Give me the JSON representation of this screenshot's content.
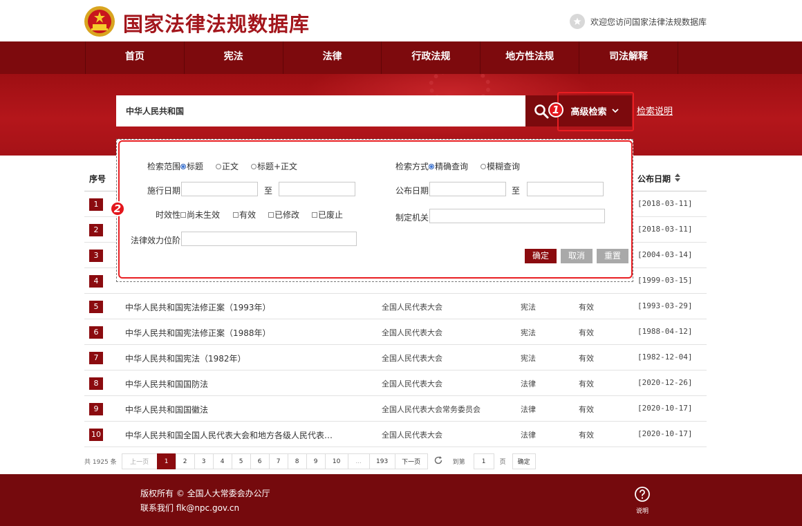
{
  "header": {
    "site_title": "国家法律法规数据库",
    "welcome": "欢迎您访问国家法律法规数据库"
  },
  "nav": [
    "首页",
    "宪法",
    "法律",
    "行政法规",
    "地方性法规",
    "司法解释"
  ],
  "search": {
    "value": "中华人民共和国",
    "advanced_label": "高级检索",
    "help_label": "检索说明"
  },
  "badges": [
    "1",
    "2"
  ],
  "advanced": {
    "scope_label": "检索范围",
    "scope_options": [
      "标题",
      "正文",
      "标题+正文"
    ],
    "method_label": "检索方式",
    "method_options": [
      "精确查询",
      "模糊查询"
    ],
    "exec_date_label": "施行日期",
    "pub_date_label": "公布日期",
    "to_label": "至",
    "validity_label": "时效性",
    "validity_options": [
      "尚未生效",
      "有效",
      "已修改",
      "已废止"
    ],
    "authority_label": "制定机关",
    "level_label": "法律效力位阶",
    "confirm": "确定",
    "cancel": "取消",
    "reset": "重置"
  },
  "table": {
    "col_num": "序号",
    "col_date": "公布日期",
    "rows": [
      {
        "num": "1",
        "title": "",
        "org": "",
        "type": "",
        "status": "",
        "date": "[2018-03-11]"
      },
      {
        "num": "2",
        "title": "",
        "org": "",
        "type": "",
        "status": "",
        "date": "[2018-03-11]"
      },
      {
        "num": "3",
        "title": "",
        "org": "",
        "type": "",
        "status": "",
        "date": "[2004-03-14]"
      },
      {
        "num": "4",
        "title": "",
        "org": "",
        "type": "",
        "status": "",
        "date": "[1999-03-15]"
      },
      {
        "num": "5",
        "title": "中华人民共和国宪法修正案（1993年）",
        "org": "全国人民代表大会",
        "type": "宪法",
        "status": "有效",
        "date": "[1993-03-29]"
      },
      {
        "num": "6",
        "title": "中华人民共和国宪法修正案（1988年）",
        "org": "全国人民代表大会",
        "type": "宪法",
        "status": "有效",
        "date": "[1988-04-12]"
      },
      {
        "num": "7",
        "title": "中华人民共和国宪法（1982年）",
        "org": "全国人民代表大会",
        "type": "宪法",
        "status": "有效",
        "date": "[1982-12-04]"
      },
      {
        "num": "8",
        "title": "中华人民共和国国防法",
        "org": "全国人民代表大会",
        "type": "法律",
        "status": "有效",
        "date": "[2020-12-26]"
      },
      {
        "num": "9",
        "title": "中华人民共和国国徽法",
        "org": "全国人民代表大会常务委员会",
        "type": "法律",
        "status": "有效",
        "date": "[2020-10-17]"
      },
      {
        "num": "10",
        "title": "中华人民共和国全国人民代表大会和地方各级人民代表…",
        "org": "全国人民代表大会",
        "type": "法律",
        "status": "有效",
        "date": "[2020-10-17]"
      }
    ]
  },
  "pager": {
    "total": "共 1925 条",
    "prev": "上一页",
    "pages": [
      "1",
      "2",
      "3",
      "4",
      "5",
      "6",
      "7",
      "8",
      "9",
      "10",
      "...",
      "193"
    ],
    "next": "下一页",
    "goto": "到第",
    "goto_value": "1",
    "page_unit": "页",
    "confirm": "确定"
  },
  "footer": {
    "copyright": "版权所有 © 全国人大常委会办公厅",
    "contact": "联系我们 flk@npc.gov.cn",
    "help": "说明"
  }
}
